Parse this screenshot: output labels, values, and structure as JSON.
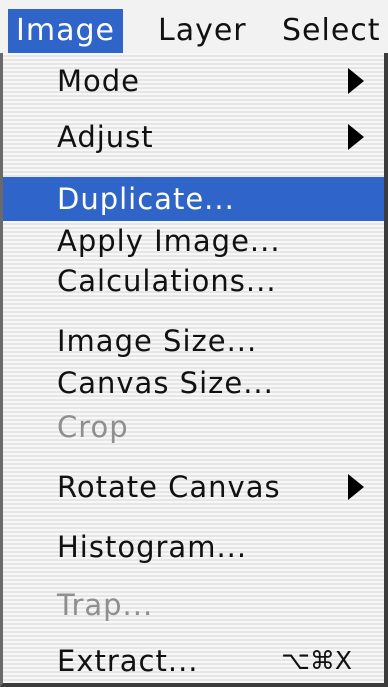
{
  "menubar": {
    "items": [
      {
        "label": "Image",
        "active": true
      },
      {
        "label": "Layer",
        "active": false
      },
      {
        "label": "Select",
        "active": false
      }
    ]
  },
  "menu": {
    "items": [
      {
        "label": "Mode",
        "submenu": true,
        "enabled": true
      },
      {
        "label": "Adjust",
        "submenu": true,
        "enabled": true
      },
      {
        "label": "Duplicate...",
        "selected": true,
        "enabled": true
      },
      {
        "label": "Apply Image...",
        "enabled": true
      },
      {
        "label": "Calculations...",
        "enabled": true
      },
      {
        "label": "Image Size...",
        "enabled": true
      },
      {
        "label": "Canvas Size...",
        "enabled": true
      },
      {
        "label": "Crop",
        "enabled": false
      },
      {
        "label": "Rotate Canvas",
        "submenu": true,
        "enabled": true
      },
      {
        "label": "Histogram...",
        "enabled": true
      },
      {
        "label": "Trap...",
        "enabled": false
      },
      {
        "label": "Extract...",
        "enabled": true,
        "shortcut": "⌥⌘X"
      }
    ]
  },
  "colors": {
    "highlight": "#2f64c8",
    "disabled_text": "#8f8f8f",
    "text": "#111111"
  }
}
